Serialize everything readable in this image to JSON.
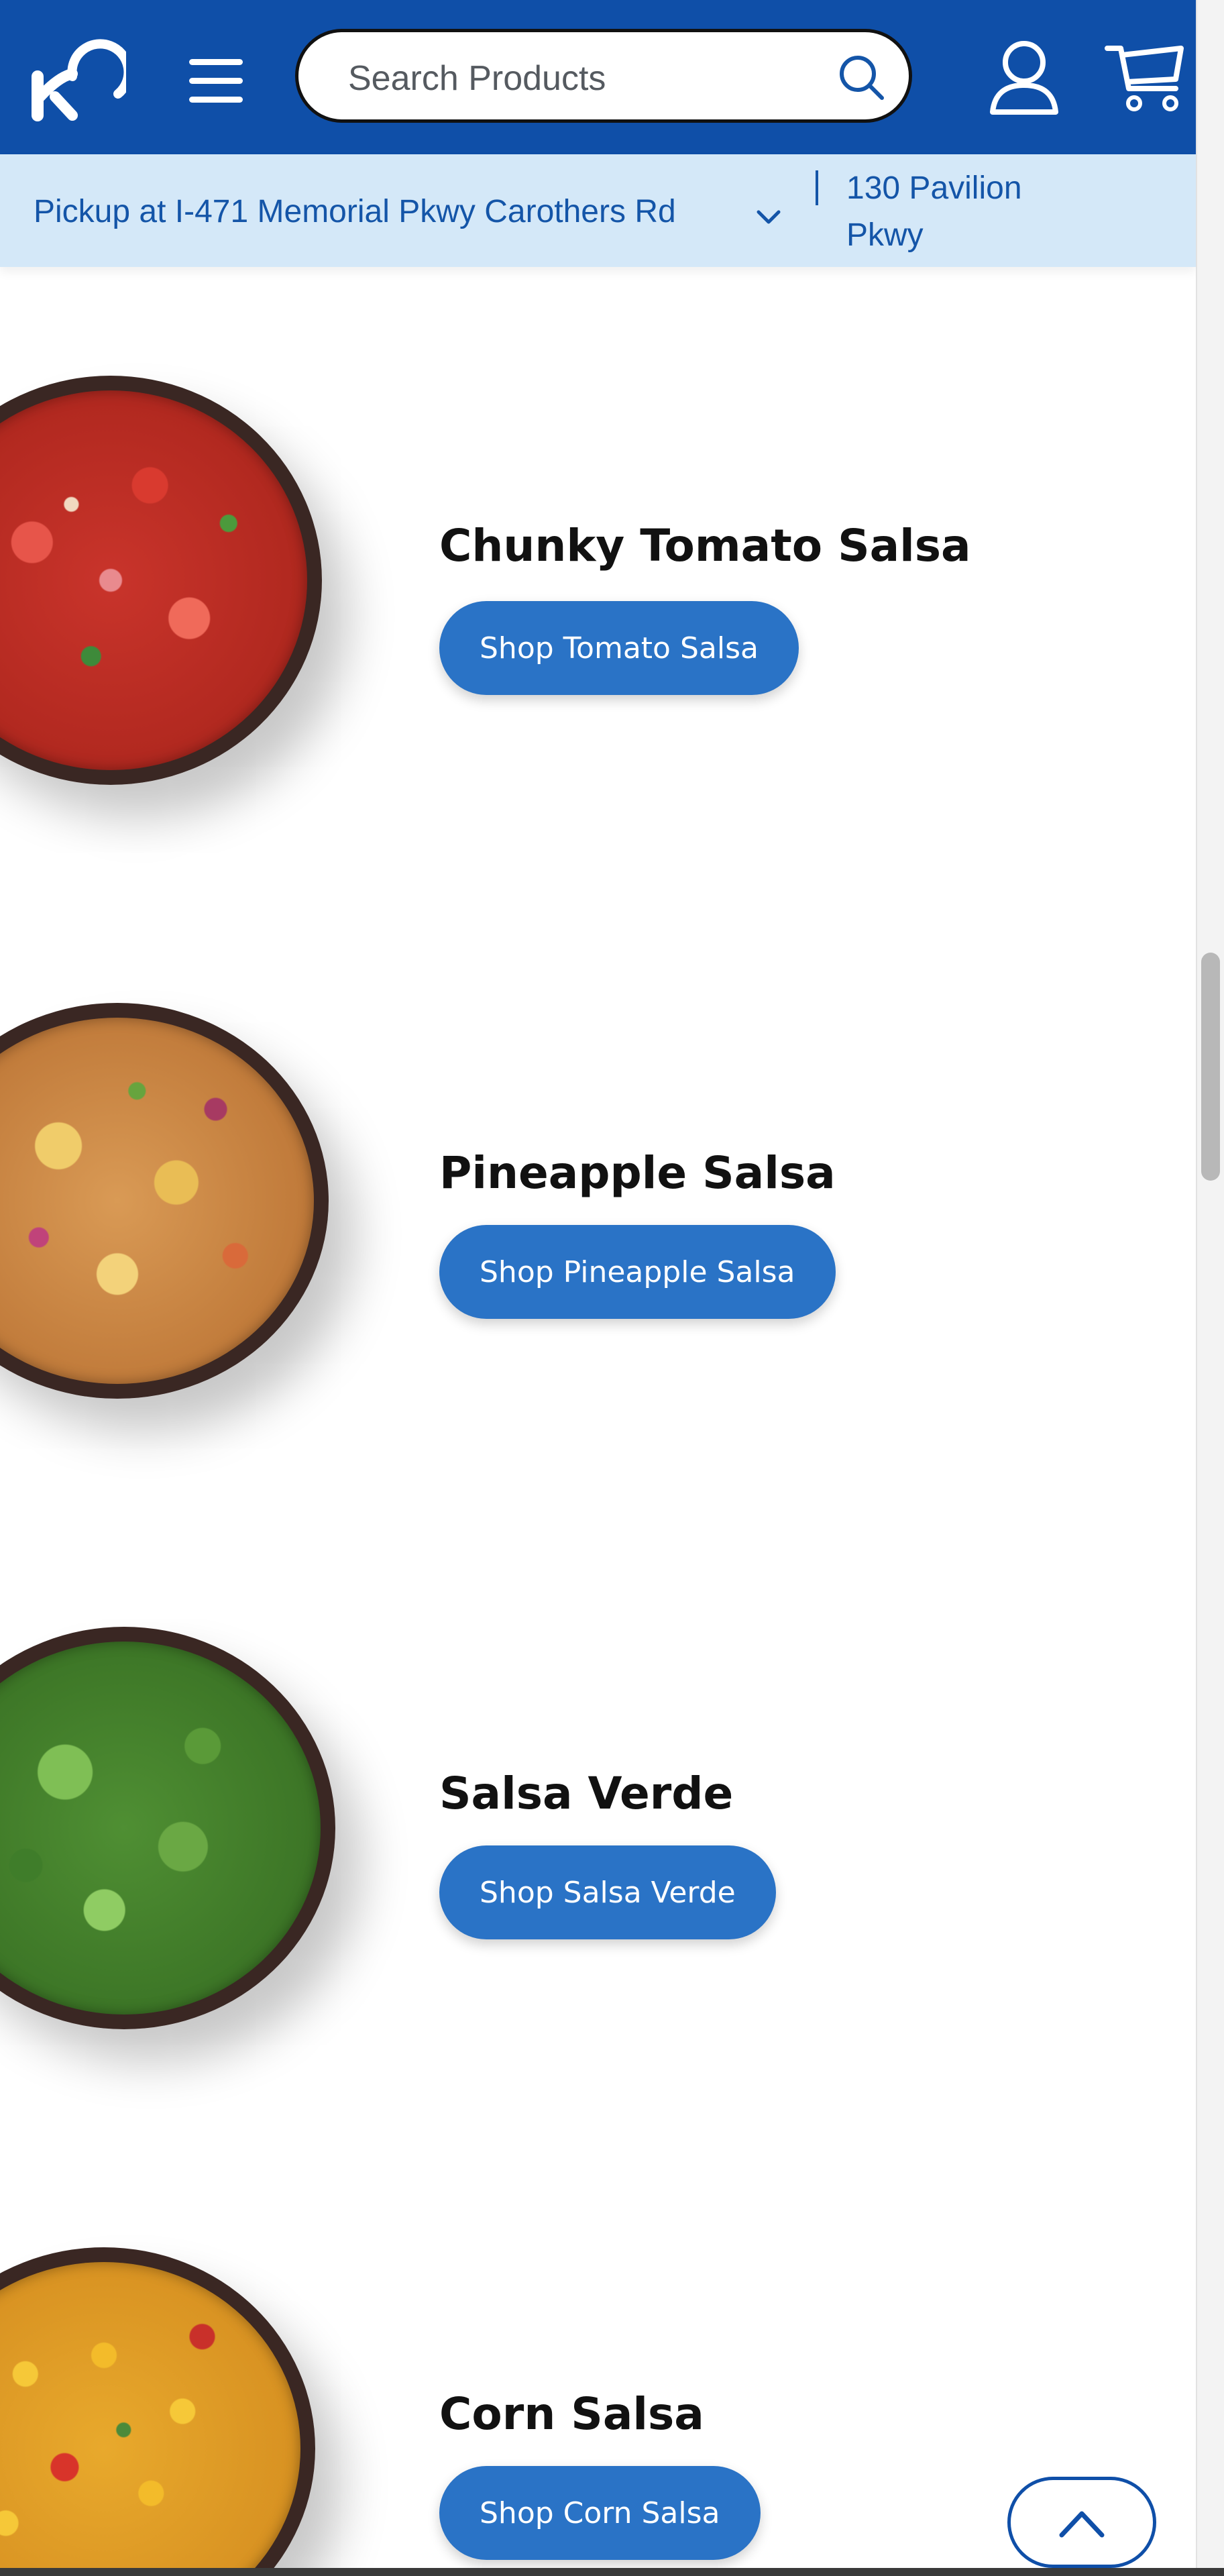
{
  "header": {
    "logo": "kroger-logo",
    "menu_icon": "hamburger-menu-icon",
    "search": {
      "placeholder": "Search Products",
      "value": ""
    },
    "account_icon": "user-icon",
    "cart_icon": "cart-icon",
    "background_color": "#0f4fa8"
  },
  "store": {
    "pickup_label": "Pickup at I-471 Memorial Pkwy Carothers Rd",
    "address_line1": "130 Pavilion",
    "address_line2": "Pkwy",
    "background_color": "#d4e8f8"
  },
  "products": [
    {
      "title": "Chunky Tomato Salsa",
      "button": "Shop Tomato Salsa",
      "image": "tomato-salsa-bowl"
    },
    {
      "title": "Pineapple Salsa",
      "button": "Shop Pineapple Salsa",
      "image": "pineapple-salsa-bowl"
    },
    {
      "title": "Salsa Verde",
      "button": "Shop Salsa Verde",
      "image": "salsa-verde-bowl"
    },
    {
      "title": "Corn Salsa",
      "button": "Shop Corn Salsa",
      "image": "corn-salsa-bowl"
    }
  ],
  "back_to_top_icon": "chevron-up-icon",
  "colors": {
    "accent": "#2a73c6",
    "brand": "#0f4fa8"
  }
}
